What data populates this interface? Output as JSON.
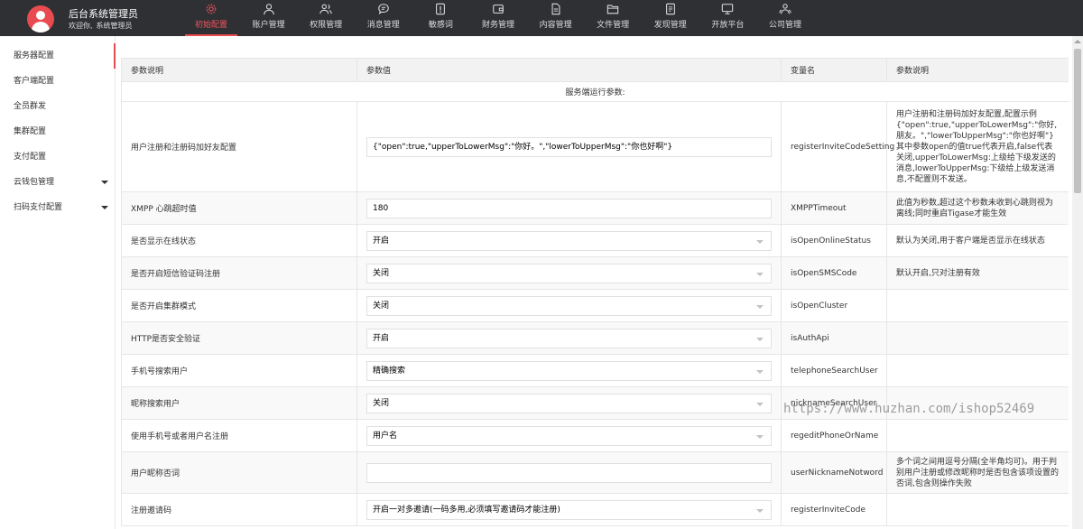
{
  "header": {
    "title": "后台系统管理员",
    "welcome": "欢迎你,",
    "username": "系统管理员",
    "nav": [
      {
        "label": "初始配置",
        "icon": "gear-icon",
        "active": true
      },
      {
        "label": "账户管理",
        "icon": "user-icon"
      },
      {
        "label": "权限管理",
        "icon": "users-icon"
      },
      {
        "label": "消息管理",
        "icon": "message-icon"
      },
      {
        "label": "敏感词",
        "icon": "exclamation-icon"
      },
      {
        "label": "财务管理",
        "icon": "wallet-icon"
      },
      {
        "label": "内容管理",
        "icon": "document-icon"
      },
      {
        "label": "文件管理",
        "icon": "folder-icon"
      },
      {
        "label": "发现管理",
        "icon": "file-text-icon"
      },
      {
        "label": "开放平台",
        "icon": "monitor-icon"
      },
      {
        "label": "公司管理",
        "icon": "group-icon"
      }
    ]
  },
  "sidebar": {
    "items": [
      {
        "label": "服务器配置",
        "active": true
      },
      {
        "label": "客户端配置"
      },
      {
        "label": "全员群发"
      },
      {
        "label": "集群配置"
      },
      {
        "label": "支付配置"
      },
      {
        "label": "云钱包管理",
        "expandable": true
      },
      {
        "label": "扫码支付配置",
        "expandable": true
      }
    ]
  },
  "table": {
    "headers": [
      "参数说明",
      "参数值",
      "变量名",
      "参数说明"
    ],
    "section": "服务端运行参数:",
    "rows": [
      {
        "name": "用户注册和注册码加好友配置",
        "value": "{\"open\":true,\"upperToLowerMsg\":\"你好。\",\"lowerToUpperMsg\":\"你也好啊\"}",
        "type": "input",
        "var": "registerInviteCodeSetting",
        "desc": "用户注册和注册码加好友配置,配置示例{\"open\":true,\"upperToLowerMsg\":\"你好,朋友。\",\"lowerToUpperMsg\":\"你也好啊\"} 其中参数open的值true代表开启,false代表关闭,upperToLowerMsg:上级给下级发送的消息,lowerToUpperMsg:下级给上级发送消息,不配置则不发送。"
      },
      {
        "name": "XMPP 心跳超时值",
        "value": "180",
        "type": "input",
        "var": "XMPPTimeout",
        "desc": "此值为秒数,超过这个秒数未收到心跳则视为离线;同时重启Tigase才能生效"
      },
      {
        "name": "是否显示在线状态",
        "value": "开启",
        "type": "select",
        "var": "isOpenOnlineStatus",
        "desc": "默认为关闭,用于客户端是否显示在线状态"
      },
      {
        "name": "是否开启短信验证码注册",
        "value": "关闭",
        "type": "select",
        "var": "isOpenSMSCode",
        "desc": "默认开启,只对注册有效"
      },
      {
        "name": "是否开启集群模式",
        "value": "关闭",
        "type": "select",
        "var": "isOpenCluster",
        "desc": ""
      },
      {
        "name": "HTTP是否安全验证",
        "value": "开启",
        "type": "select",
        "var": "isAuthApi",
        "desc": ""
      },
      {
        "name": "手机号搜索用户",
        "value": "精确搜索",
        "type": "select",
        "var": "telephoneSearchUser",
        "desc": ""
      },
      {
        "name": "昵称搜索用户",
        "value": "关闭",
        "type": "select",
        "var": "nicknameSearchUser",
        "desc": ""
      },
      {
        "name": "使用手机号或者用户名注册",
        "value": "用户名",
        "type": "select",
        "var": "regeditPhoneOrName",
        "desc": ""
      },
      {
        "name": "用户昵称否词",
        "value": "",
        "type": "input",
        "var": "userNicknameNotword",
        "desc": "多个词之间用逗号分隔(全半角均可)。用于判别用户注册或修改昵称时是否包含该项设置的否词,包含则操作失败"
      },
      {
        "name": "注册邀请码",
        "value": "开启一对多邀请(一码多用,必须填写邀请码才能注册)",
        "type": "select",
        "var": "registerInviteCode",
        "desc": ""
      }
    ]
  },
  "watermark": "https://www.huzhan.com/ishop52469",
  "colors": {
    "topbar": "#2f3034",
    "accent": "#e84b50"
  }
}
